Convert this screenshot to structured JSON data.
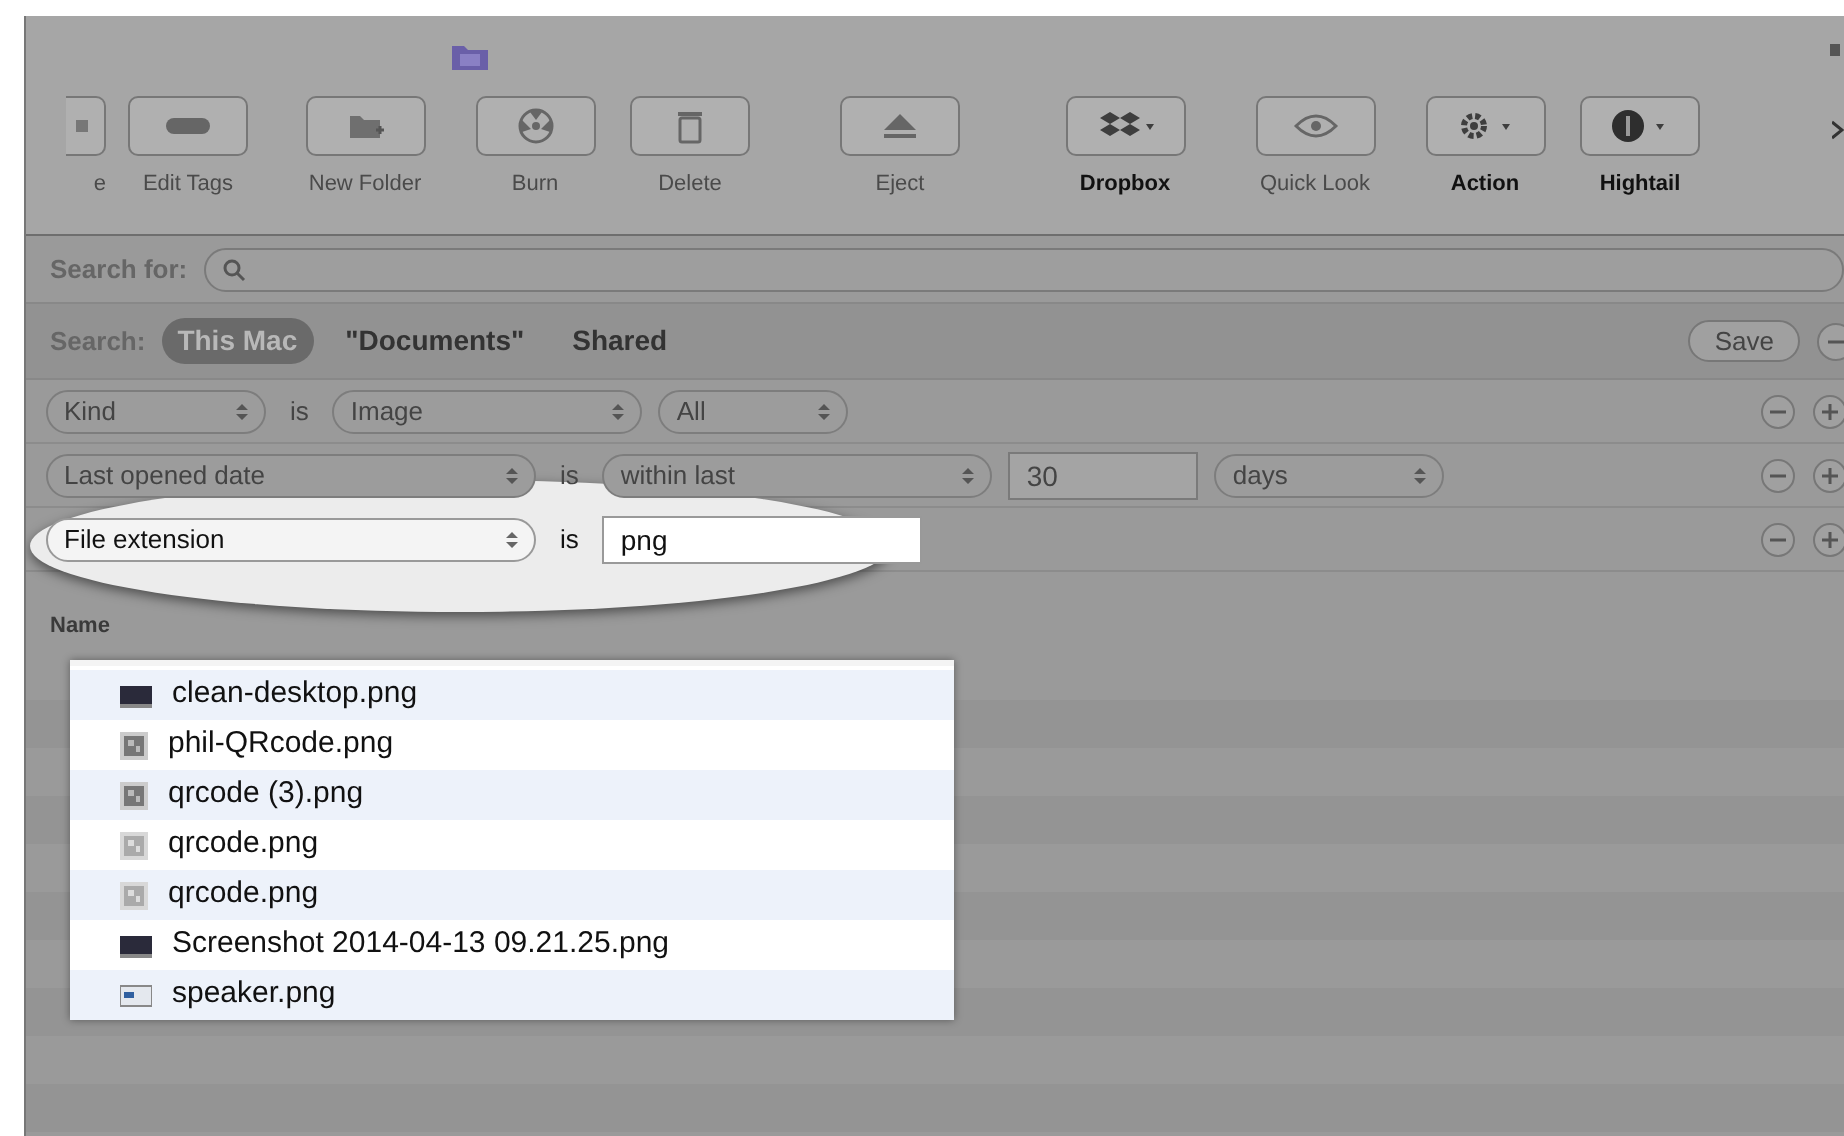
{
  "toolbar": [
    {
      "label": "e",
      "disabled": true
    },
    {
      "label": "Edit Tags",
      "disabled": true
    },
    {
      "label": "New Folder",
      "disabled": true
    },
    {
      "label": "Burn",
      "disabled": true
    },
    {
      "label": "Delete",
      "disabled": true
    },
    {
      "label": "Eject",
      "disabled": true
    },
    {
      "label": "Dropbox",
      "disabled": false
    },
    {
      "label": "Quick Look",
      "disabled": true
    },
    {
      "label": "Action",
      "disabled": false
    },
    {
      "label": "Hightail",
      "disabled": false
    }
  ],
  "search_for": {
    "label": "Search for:"
  },
  "scope": {
    "label": "Search:",
    "options": [
      {
        "label": "This Mac",
        "selected": true
      },
      {
        "label": "\"Documents\"",
        "selected": false
      },
      {
        "label": "Shared",
        "selected": false
      }
    ],
    "save": "Save"
  },
  "criteria": [
    {
      "highlighted": false,
      "parts": [
        {
          "kind": "popup",
          "text": "Kind"
        },
        {
          "kind": "word",
          "text": "is"
        },
        {
          "kind": "popup",
          "text": "Image"
        },
        {
          "kind": "popup",
          "text": "All"
        }
      ]
    },
    {
      "highlighted": false,
      "parts": [
        {
          "kind": "popup",
          "text": "Last opened date"
        },
        {
          "kind": "word",
          "text": "is"
        },
        {
          "kind": "popup",
          "text": "within last"
        },
        {
          "kind": "field",
          "text": "30"
        },
        {
          "kind": "popup",
          "text": "days"
        }
      ]
    },
    {
      "highlighted": true,
      "parts": [
        {
          "kind": "popup",
          "text": "File extension"
        },
        {
          "kind": "word",
          "text": "is"
        },
        {
          "kind": "field",
          "text": "png"
        }
      ]
    }
  ],
  "results": {
    "column": "Name",
    "files": [
      {
        "name": "clean-desktop.png",
        "kind": "screen"
      },
      {
        "name": "phil-QRcode.png",
        "kind": "qr"
      },
      {
        "name": "qrcode (3).png",
        "kind": "qr"
      },
      {
        "name": "qrcode.png",
        "kind": "qrlight"
      },
      {
        "name": "qrcode.png",
        "kind": "qrlight"
      },
      {
        "name": "Screenshot 2014-04-13 09.21.25.png",
        "kind": "screen"
      },
      {
        "name": "speaker.png",
        "kind": "card"
      }
    ]
  }
}
